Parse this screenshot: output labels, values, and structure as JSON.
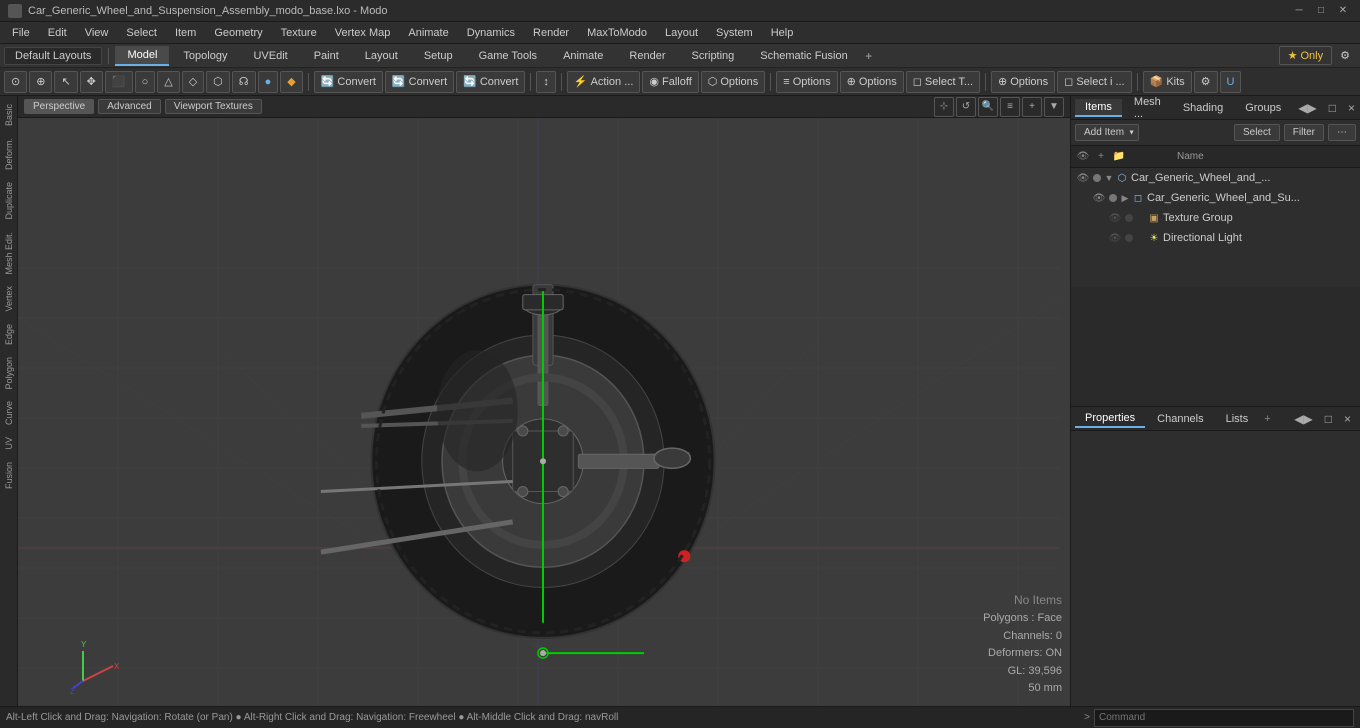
{
  "titlebar": {
    "title": "Car_Generic_Wheel_and_Suspension_Assembly_modo_base.lxo - Modo",
    "controls": [
      "─",
      "□",
      "✕"
    ]
  },
  "menubar": {
    "items": [
      "File",
      "Edit",
      "View",
      "Select",
      "Item",
      "Geometry",
      "Texture",
      "Vertex Map",
      "Animate",
      "Dynamics",
      "Render",
      "MaxToModo",
      "Layout",
      "System",
      "Help"
    ]
  },
  "layouts": {
    "default": "Default Layouts",
    "tabs": [
      "Model",
      "Topology",
      "UVEdit",
      "Paint",
      "Layout",
      "Setup",
      "Game Tools",
      "Animate",
      "Render",
      "Scripting",
      "Schematic Fusion"
    ],
    "active": "Model",
    "only": "★  Only",
    "add_icon": "+"
  },
  "toolbar": {
    "buttons": [
      {
        "label": "⊙",
        "type": "icon"
      },
      {
        "label": "⊕",
        "type": "icon"
      },
      {
        "label": "↖",
        "type": "icon"
      },
      {
        "label": "✥",
        "type": "icon"
      },
      {
        "label": "⬛",
        "type": "icon"
      },
      {
        "label": "○",
        "type": "icon"
      },
      {
        "label": "△",
        "type": "icon"
      },
      {
        "label": "◇",
        "type": "icon"
      },
      {
        "label": "⬡",
        "type": "icon"
      },
      {
        "label": "☊",
        "type": "icon"
      },
      {
        "label": "🔵",
        "type": "icon"
      },
      {
        "label": "🔶",
        "type": "icon"
      },
      {
        "separator": true
      },
      {
        "label": "Convert",
        "icon": "🔄",
        "type": "convert"
      },
      {
        "label": "Convert",
        "icon": "🔄",
        "type": "convert"
      },
      {
        "label": "Convert",
        "icon": "🔄",
        "type": "convert"
      },
      {
        "separator": true
      },
      {
        "label": "↕",
        "icon": "↕",
        "type": "icon"
      },
      {
        "separator": true
      },
      {
        "label": "Action ...",
        "icon": "⚡",
        "type": "dropdown"
      },
      {
        "label": "Falloff",
        "icon": "◉",
        "type": "dropdown"
      },
      {
        "label": "Options",
        "icon": "⬡",
        "type": "dropdown"
      },
      {
        "separator": true
      },
      {
        "label": "Options",
        "icon": "≡",
        "type": "btn"
      },
      {
        "label": "Options",
        "icon": "⊕",
        "type": "btn"
      },
      {
        "label": "Select T...",
        "icon": "◻",
        "type": "btn"
      },
      {
        "separator": true
      },
      {
        "label": "Options",
        "icon": "⊕",
        "type": "btn"
      },
      {
        "label": "Select i ...",
        "icon": "◻",
        "type": "btn"
      },
      {
        "separator": true
      },
      {
        "label": "Kits",
        "icon": "📦",
        "type": "dropdown"
      },
      {
        "label": "⚙",
        "type": "icon"
      },
      {
        "label": "U",
        "type": "icon-u"
      }
    ]
  },
  "viewport": {
    "header_tabs": [
      "Perspective",
      "Advanced",
      "Viewport Textures"
    ],
    "active_tab": "Perspective",
    "controls": [
      "⊹",
      "↺",
      "🔍",
      "≡",
      "+",
      "▼"
    ],
    "status": {
      "no_items": "No Items",
      "polygons": "Polygons : Face",
      "channels": "Channels: 0",
      "deformers": "Deformers: ON",
      "gl": "GL: 39,596",
      "unit": "50 mm"
    }
  },
  "left_sidebar": {
    "tabs": [
      "Basic",
      "Deform.",
      "Duplicate",
      "Mesh Edit.",
      "Vertex",
      "Edge",
      "Polygon",
      "Curve",
      "UV",
      "Fusion"
    ]
  },
  "right_panel": {
    "tabs": [
      "Items",
      "Mesh ...",
      "Shading",
      "Groups"
    ],
    "active": "Items",
    "controls": [
      "◀▶",
      "□",
      "×"
    ],
    "toolbar": {
      "add_item": "Add Item",
      "select": "Select",
      "filter": "Filter"
    },
    "tree": [
      {
        "level": 0,
        "label": "Car_Generic_Wheel_and_...",
        "type": "assembly",
        "expanded": true,
        "eye": true
      },
      {
        "level": 1,
        "label": "Car_Generic_Wheel_and_Su...",
        "type": "mesh",
        "expanded": false,
        "eye": true
      },
      {
        "level": 2,
        "label": "Texture Group",
        "type": "texture",
        "expanded": false,
        "eye": false
      },
      {
        "level": 2,
        "label": "Directional Light",
        "type": "light",
        "expanded": false,
        "eye": false
      }
    ]
  },
  "properties": {
    "tabs": [
      "Properties",
      "Channels",
      "Lists"
    ],
    "active": "Properties",
    "add_tab": "+"
  },
  "statusbar": {
    "text": "Alt-Left Click and Drag: Navigation: Rotate (or Pan)  ●  Alt-Right Click and Drag: Navigation: Freewheel  ●  Alt-Middle Click and Drag: navRoll",
    "prompt_char": ">",
    "command_placeholder": "Command"
  }
}
